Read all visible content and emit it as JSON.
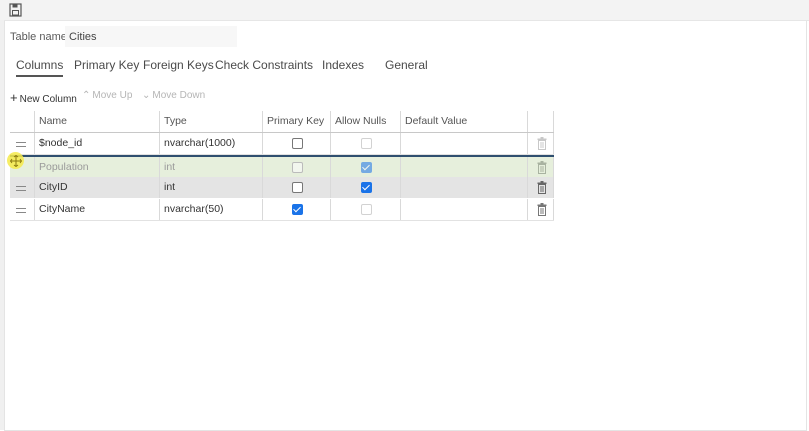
{
  "table_name": {
    "label": "Table name",
    "value": "Cities"
  },
  "tabs": [
    {
      "label": "Columns",
      "active": true
    },
    {
      "label": "Primary Key"
    },
    {
      "label": "Foreign Keys"
    },
    {
      "label": "Check Constraints"
    },
    {
      "label": "Indexes"
    },
    {
      "label": "General"
    }
  ],
  "actions": {
    "new_column": "New Column",
    "move_up": "Move Up",
    "move_down": "Move Down"
  },
  "grid": {
    "headers": {
      "name": "Name",
      "type": "Type",
      "primary_key": "Primary Key",
      "allow_nulls": "Allow Nulls",
      "default_value": "Default Value"
    },
    "rows": [
      {
        "name": "$node_id",
        "type": "nvarchar(1000)",
        "primary_key": false,
        "allow_nulls": false,
        "allow_nulls_disabled": true,
        "default_value": "",
        "state": "normal"
      },
      {
        "name": "Population",
        "type": "int",
        "primary_key": false,
        "allow_nulls": true,
        "default_value": "",
        "state": "dragging"
      },
      {
        "name": "CityID",
        "type": "int",
        "primary_key": false,
        "allow_nulls": true,
        "default_value": "",
        "state": "selected"
      },
      {
        "name": "CityName",
        "type": "nvarchar(50)",
        "primary_key": true,
        "allow_nulls": false,
        "allow_nulls_disabled": true,
        "default_value": "",
        "state": "normal"
      }
    ]
  },
  "icons": {
    "save": "save-icon",
    "new_column": "plus-icon",
    "move_up": "chevron-up-icon",
    "move_down": "chevron-down-icon",
    "drag": "drag-handle-icon",
    "delete": "trash-icon"
  },
  "colors": {
    "checkbox_checked": "#1a73e8",
    "drag_row_bg": "#e6efdc",
    "selected_row_bg": "#e4e4e4",
    "drop_indicator": "#2f4f6f",
    "cursor_highlight": "#f5ea4a"
  }
}
